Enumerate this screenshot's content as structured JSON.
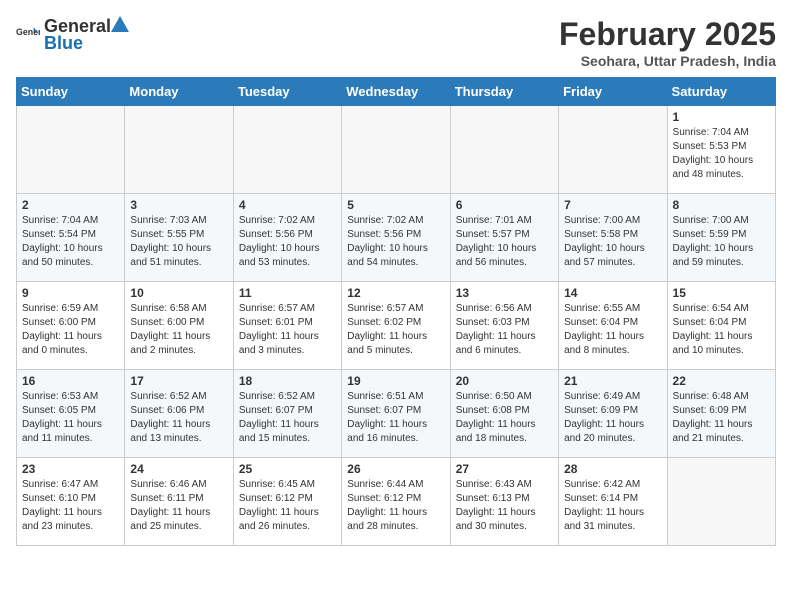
{
  "header": {
    "logo_general": "General",
    "logo_blue": "Blue",
    "title": "February 2025",
    "location": "Seohara, Uttar Pradesh, India"
  },
  "weekdays": [
    "Sunday",
    "Monday",
    "Tuesday",
    "Wednesday",
    "Thursday",
    "Friday",
    "Saturday"
  ],
  "weeks": [
    [
      {
        "day": "",
        "info": ""
      },
      {
        "day": "",
        "info": ""
      },
      {
        "day": "",
        "info": ""
      },
      {
        "day": "",
        "info": ""
      },
      {
        "day": "",
        "info": ""
      },
      {
        "day": "",
        "info": ""
      },
      {
        "day": "1",
        "info": "Sunrise: 7:04 AM\nSunset: 5:53 PM\nDaylight: 10 hours and 48 minutes."
      }
    ],
    [
      {
        "day": "2",
        "info": "Sunrise: 7:04 AM\nSunset: 5:54 PM\nDaylight: 10 hours and 50 minutes."
      },
      {
        "day": "3",
        "info": "Sunrise: 7:03 AM\nSunset: 5:55 PM\nDaylight: 10 hours and 51 minutes."
      },
      {
        "day": "4",
        "info": "Sunrise: 7:02 AM\nSunset: 5:56 PM\nDaylight: 10 hours and 53 minutes."
      },
      {
        "day": "5",
        "info": "Sunrise: 7:02 AM\nSunset: 5:56 PM\nDaylight: 10 hours and 54 minutes."
      },
      {
        "day": "6",
        "info": "Sunrise: 7:01 AM\nSunset: 5:57 PM\nDaylight: 10 hours and 56 minutes."
      },
      {
        "day": "7",
        "info": "Sunrise: 7:00 AM\nSunset: 5:58 PM\nDaylight: 10 hours and 57 minutes."
      },
      {
        "day": "8",
        "info": "Sunrise: 7:00 AM\nSunset: 5:59 PM\nDaylight: 10 hours and 59 minutes."
      }
    ],
    [
      {
        "day": "9",
        "info": "Sunrise: 6:59 AM\nSunset: 6:00 PM\nDaylight: 11 hours and 0 minutes."
      },
      {
        "day": "10",
        "info": "Sunrise: 6:58 AM\nSunset: 6:00 PM\nDaylight: 11 hours and 2 minutes."
      },
      {
        "day": "11",
        "info": "Sunrise: 6:57 AM\nSunset: 6:01 PM\nDaylight: 11 hours and 3 minutes."
      },
      {
        "day": "12",
        "info": "Sunrise: 6:57 AM\nSunset: 6:02 PM\nDaylight: 11 hours and 5 minutes."
      },
      {
        "day": "13",
        "info": "Sunrise: 6:56 AM\nSunset: 6:03 PM\nDaylight: 11 hours and 6 minutes."
      },
      {
        "day": "14",
        "info": "Sunrise: 6:55 AM\nSunset: 6:04 PM\nDaylight: 11 hours and 8 minutes."
      },
      {
        "day": "15",
        "info": "Sunrise: 6:54 AM\nSunset: 6:04 PM\nDaylight: 11 hours and 10 minutes."
      }
    ],
    [
      {
        "day": "16",
        "info": "Sunrise: 6:53 AM\nSunset: 6:05 PM\nDaylight: 11 hours and 11 minutes."
      },
      {
        "day": "17",
        "info": "Sunrise: 6:52 AM\nSunset: 6:06 PM\nDaylight: 11 hours and 13 minutes."
      },
      {
        "day": "18",
        "info": "Sunrise: 6:52 AM\nSunset: 6:07 PM\nDaylight: 11 hours and 15 minutes."
      },
      {
        "day": "19",
        "info": "Sunrise: 6:51 AM\nSunset: 6:07 PM\nDaylight: 11 hours and 16 minutes."
      },
      {
        "day": "20",
        "info": "Sunrise: 6:50 AM\nSunset: 6:08 PM\nDaylight: 11 hours and 18 minutes."
      },
      {
        "day": "21",
        "info": "Sunrise: 6:49 AM\nSunset: 6:09 PM\nDaylight: 11 hours and 20 minutes."
      },
      {
        "day": "22",
        "info": "Sunrise: 6:48 AM\nSunset: 6:09 PM\nDaylight: 11 hours and 21 minutes."
      }
    ],
    [
      {
        "day": "23",
        "info": "Sunrise: 6:47 AM\nSunset: 6:10 PM\nDaylight: 11 hours and 23 minutes."
      },
      {
        "day": "24",
        "info": "Sunrise: 6:46 AM\nSunset: 6:11 PM\nDaylight: 11 hours and 25 minutes."
      },
      {
        "day": "25",
        "info": "Sunrise: 6:45 AM\nSunset: 6:12 PM\nDaylight: 11 hours and 26 minutes."
      },
      {
        "day": "26",
        "info": "Sunrise: 6:44 AM\nSunset: 6:12 PM\nDaylight: 11 hours and 28 minutes."
      },
      {
        "day": "27",
        "info": "Sunrise: 6:43 AM\nSunset: 6:13 PM\nDaylight: 11 hours and 30 minutes."
      },
      {
        "day": "28",
        "info": "Sunrise: 6:42 AM\nSunset: 6:14 PM\nDaylight: 11 hours and 31 minutes."
      },
      {
        "day": "",
        "info": ""
      }
    ]
  ]
}
